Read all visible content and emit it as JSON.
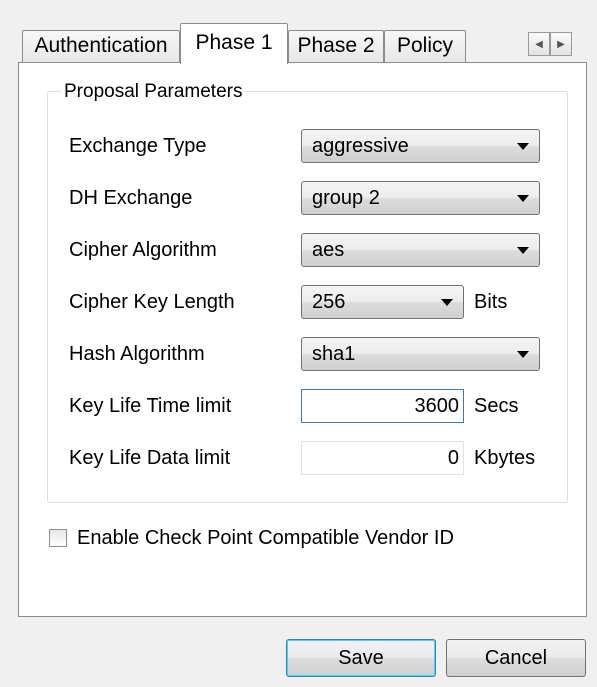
{
  "tabs": [
    {
      "label": "Authentication"
    },
    {
      "label": "Phase 1",
      "active": true
    },
    {
      "label": "Phase 2"
    },
    {
      "label": "Policy"
    }
  ],
  "tab_scroll": {
    "left_icon": "triangle-left-icon",
    "right_icon": "triangle-right-icon"
  },
  "group": {
    "title": "Proposal Parameters"
  },
  "fields": {
    "exchange_type": {
      "label": "Exchange Type",
      "value": "aggressive"
    },
    "dh_exchange": {
      "label": "DH Exchange",
      "value": "group 2"
    },
    "cipher_algorithm": {
      "label": "Cipher Algorithm",
      "value": "aes"
    },
    "cipher_key_length": {
      "label": "Cipher Key Length",
      "value": "256",
      "unit": "Bits"
    },
    "hash_algorithm": {
      "label": "Hash Algorithm",
      "value": "sha1"
    },
    "key_life_time": {
      "label": "Key Life Time limit",
      "value": "3600",
      "unit": "Secs"
    },
    "key_life_data": {
      "label": "Key Life Data limit",
      "value": "0",
      "unit": "Kbytes"
    }
  },
  "checkbox": {
    "label": "Enable Check Point Compatible Vendor ID",
    "checked": false
  },
  "buttons": {
    "save": "Save",
    "cancel": "Cancel"
  },
  "colors": {
    "focus_border": "#3d7bad",
    "default_button_border": "#3c7fb1",
    "group_border": "#d5dfe5"
  }
}
